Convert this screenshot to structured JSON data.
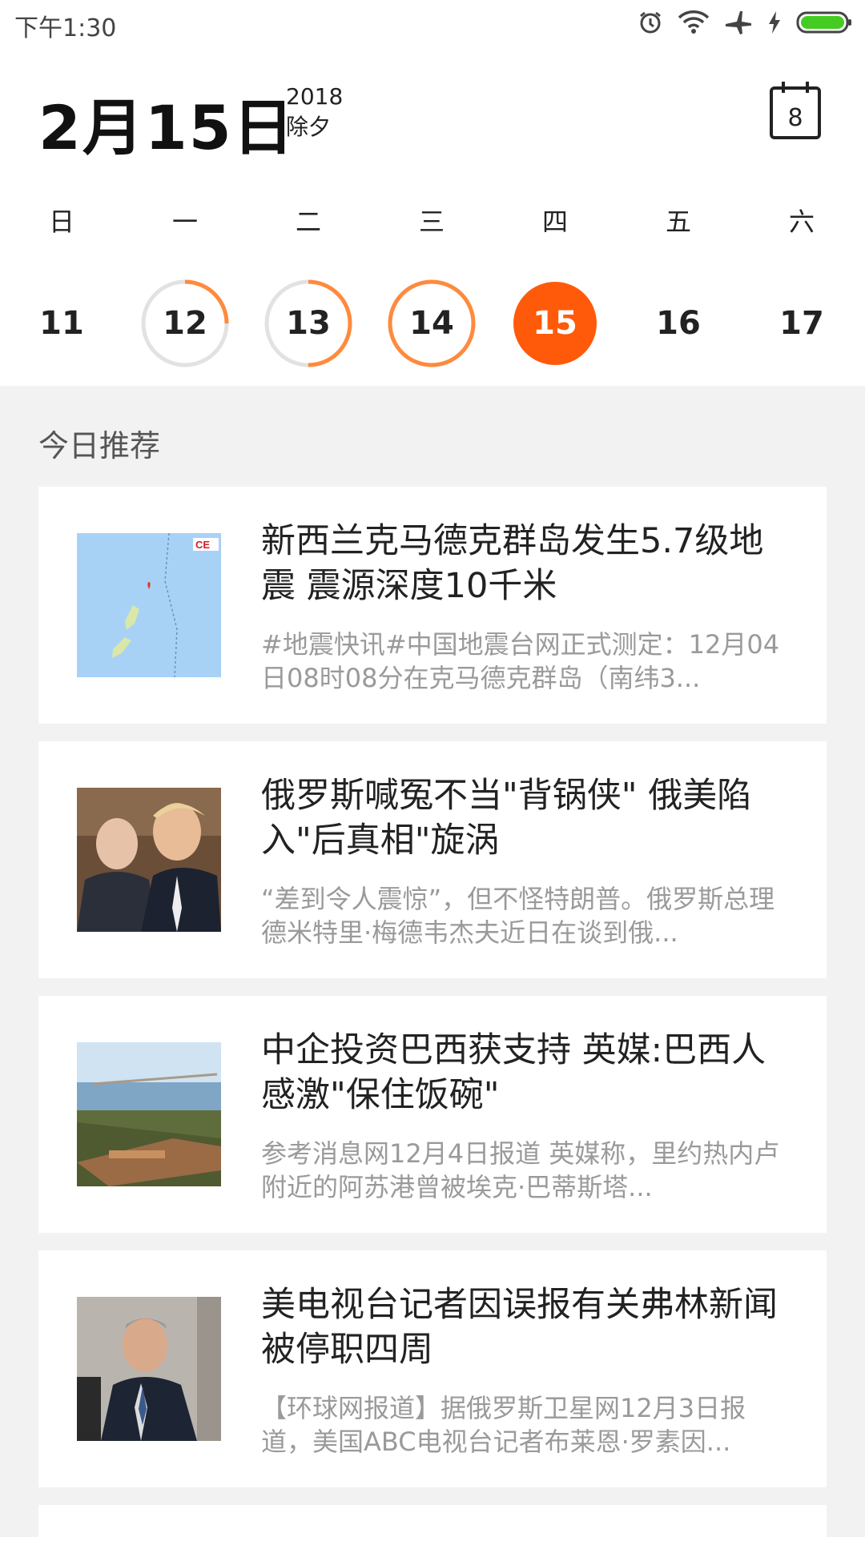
{
  "status_bar": {
    "time": "下午1:30",
    "icons": [
      "alarm-icon",
      "wifi-icon",
      "airplane-icon",
      "charging-icon",
      "battery-icon"
    ],
    "battery_color": "#44cc22"
  },
  "header": {
    "date": "2月15日",
    "year": "2018",
    "festival": "除夕",
    "calendar_button_day": "8"
  },
  "week": {
    "labels": [
      "日",
      "一",
      "二",
      "三",
      "四",
      "五",
      "六"
    ],
    "days": [
      {
        "num": "11",
        "progress": 0
      },
      {
        "num": "12",
        "progress": 0.25
      },
      {
        "num": "13",
        "progress": 0.5
      },
      {
        "num": "14",
        "progress": 1
      },
      {
        "num": "15",
        "selected": true
      },
      {
        "num": "16",
        "progress": 0
      },
      {
        "num": "17",
        "progress": 0
      }
    ],
    "accent_color": "#ff5a0a",
    "ring_color": "#ff8a3d"
  },
  "recommend": {
    "section_title": "今日推荐",
    "articles": [
      {
        "title": "新西兰克马德克群岛发生5.7级地震 震源深度10千米",
        "desc": "#地震快讯#中国地震台网正式测定：12月04日08时08分在克马德克群岛（南纬3...",
        "thumb": "map-thumbnail"
      },
      {
        "title": "俄罗斯喊冤不当\"背锅侠\" 俄美陷入\"后真相\"旋涡",
        "desc": "“差到令人震惊”，但不怪特朗普。俄罗斯总理德米特里·梅德韦杰夫近日在谈到俄...",
        "thumb": "people-photo"
      },
      {
        "title": "中企投资巴西获支持 英媒:巴西人感激\"保住饭碗\"",
        "desc": "参考消息网12月4日报道 英媒称，里约热内卢附近的阿苏港曾被埃克·巴蒂斯塔...",
        "thumb": "port-photo"
      },
      {
        "title": "美电视台记者因误报有关弗林新闻被停职四周",
        "desc": "【环球网报道】据俄罗斯卫星网12月3日报道，美国ABC电视台记者布莱恩·罗素因...",
        "thumb": "man-photo"
      }
    ]
  }
}
